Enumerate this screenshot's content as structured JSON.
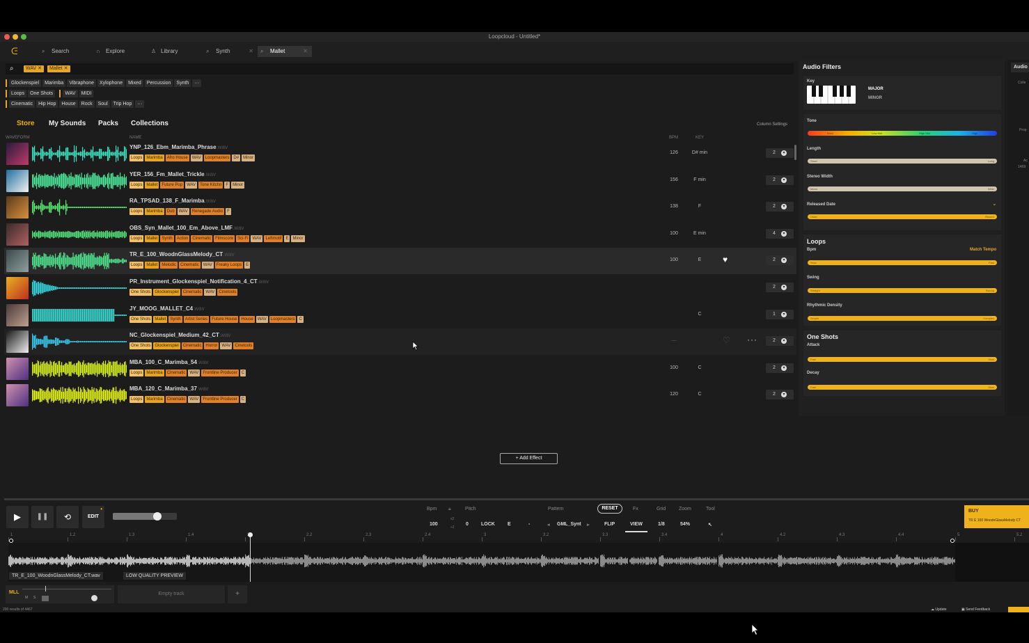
{
  "window": {
    "title": "Loopcloud - Untitled*"
  },
  "tabs": [
    {
      "icon": "search-icon",
      "label": "Search"
    },
    {
      "icon": "headphones-icon",
      "label": "Explore"
    },
    {
      "icon": "person-icon",
      "label": "Library"
    },
    {
      "icon": "search-icon",
      "label": "Synth"
    },
    {
      "icon": "search-icon",
      "label": "Mallet"
    }
  ],
  "search": {
    "chips": [
      "WAV",
      "Mallet"
    ]
  },
  "filters": {
    "row1": [
      "Glockenspiel",
      "Marimba",
      "Vibraphone",
      "Xylophone",
      "Mixed",
      "Percussion",
      "Synth",
      "···"
    ],
    "row2a": [
      "Loops",
      "One Shots"
    ],
    "row2b": [
      "WAV",
      "MIDI"
    ],
    "row3": [
      "Cinematic",
      "Hip Hop",
      "House",
      "Rock",
      "Soul",
      "Trip Hop",
      "···"
    ]
  },
  "nav": {
    "store": "Store",
    "my_sounds": "My Sounds",
    "packs": "Packs",
    "collections": "Collections",
    "column_settings": "Column Settings"
  },
  "columns": {
    "waveform": "WAVEFORM",
    "name": "NAME",
    "bpm": "BPM",
    "key": "KEY"
  },
  "rows": [
    {
      "name": "YNP_126_Ebm_Marimba_Phrase",
      "ext": ".wav",
      "bpm": "126",
      "key": "D# min",
      "count": "2",
      "tags": [
        "Loops",
        "Marimba",
        "Afro House",
        "WAV",
        "Loopmasters",
        "D#",
        "Minor"
      ],
      "wave_color": "#3fe0c0"
    },
    {
      "name": "YER_156_Fm_Mallet_Trickle",
      "ext": ".wav",
      "bpm": "156",
      "key": "F min",
      "count": "2",
      "tags": [
        "Loops",
        "Mallet",
        "Future Pop",
        "WAV",
        "Tone Kitchn",
        "F",
        "Minor"
      ],
      "wave_color": "#4ae898"
    },
    {
      "name": "RA_TPSAD_138_F_Marimba",
      "ext": ".wav",
      "bpm": "138",
      "key": "F",
      "count": "2",
      "tags": [
        "Loops",
        "Marimba",
        "Dub",
        "WAV",
        "Renegade Audio",
        "F"
      ],
      "wave_color": "#5ae670"
    },
    {
      "name": "OBS_Syn_Mallet_100_Em_Above_LMF",
      "ext": ".wav",
      "bpm": "100",
      "key": "E min",
      "count": "4",
      "tags": [
        "Loops",
        "Mallet",
        "Synth",
        "Action",
        "Cinematic",
        "Filmscore",
        "Sci-Fi",
        "WAV",
        "Leftmotif",
        "E",
        "Minor"
      ],
      "wave_color": "#52e07a"
    },
    {
      "name": "TR_E_100_WoodnGlassMelody_CT",
      "ext": ".wav",
      "bpm": "100",
      "key": "E",
      "count": "2",
      "tags": [
        "Loops",
        "Mallet",
        "Melodic",
        "Cinematic",
        "WAV",
        "Freaky Loops",
        "E"
      ],
      "wave_color": "#4ee38c"
    },
    {
      "name": "PR_Instrument_Glockenspiel_Notification_4_CT",
      "ext": ".wav",
      "bpm": "",
      "key": "",
      "count": "2",
      "tags": [
        "One Shots",
        "Glockenspiel",
        "Cinematic",
        "WAV",
        "Cinetools"
      ],
      "wave_color": "#35d8e0"
    },
    {
      "name": "JY_MOOG_MALLET_C4",
      "ext": ".wav",
      "bpm": "",
      "key": "C",
      "count": "1",
      "tags": [
        "One Shots",
        "Mallet",
        "Synth",
        "Artist Series",
        "Future House",
        "House",
        "WAV",
        "Loopmasters",
        "C"
      ],
      "wave_color": "#3cd8d0"
    },
    {
      "name": "NC_Glockenspiel_Medium_42_CT",
      "ext": ".wav",
      "bpm": "—",
      "key": "",
      "count": "2",
      "tags": [
        "One Shots",
        "Glockenspiel",
        "Cinematic",
        "Horror",
        "WAV",
        "Cinetools"
      ],
      "wave_color": "#38c8ec"
    },
    {
      "name": "MBA_100_C_Marimba_54",
      "ext": ".wav",
      "bpm": "100",
      "key": "C",
      "count": "2",
      "tags": [
        "Loops",
        "Marimba",
        "Cinematic",
        "WAV",
        "Frontline Producer",
        "C"
      ],
      "wave_color": "#d7f020"
    },
    {
      "name": "MBA_120_C_Marimba_37",
      "ext": ".wav",
      "bpm": "120",
      "key": "C",
      "count": "2",
      "tags": [
        "Loops",
        "Marimba",
        "Cinematic",
        "WAV",
        "Frontline Producer",
        "C"
      ],
      "wave_color": "#e2f21a"
    }
  ],
  "add_effect": "+ Add Effect",
  "audio_filters": {
    "title": "Audio Filters",
    "key_label": "Key",
    "major": "MAJOR",
    "minor": "MINOR",
    "tone": {
      "label": "Tone",
      "stops": [
        "Bass",
        "Low Mid",
        "High Mid",
        "High"
      ]
    },
    "length": {
      "label": "Length",
      "left": "Short",
      "right": "Long"
    },
    "stereo": {
      "label": "Stereo Width",
      "left": "Mono",
      "right": "Wide"
    },
    "released": {
      "label": "Released Date",
      "left": "Older",
      "right": "Recent"
    },
    "loops_title": "Loops",
    "bpm": {
      "label": "Bpm",
      "match": "Match Tempo",
      "left": "Slow",
      "right": "Fast"
    },
    "swing": {
      "label": "Swing",
      "left": "Straight",
      "right": "Swung"
    },
    "density": {
      "label": "Rhythmic Density",
      "left": "Simple",
      "right": "Complex"
    },
    "oneshots_title": "One Shots",
    "attack": {
      "label": "Attack",
      "left": "Fast",
      "right": "Slow"
    },
    "decay": {
      "label": "Decay",
      "left": "Fast",
      "right": "Slow"
    }
  },
  "far_right": {
    "tab": "Audio",
    "labels": [
      "Colle",
      "Prop",
      "Ac",
      "1469"
    ]
  },
  "transport": {
    "edit": "EDIT",
    "volume_level": 0.7,
    "bpm_label": "Bpm",
    "bpm_value": "100",
    "pitch_label": "Pitch",
    "pitch_value": "0",
    "lock": "LOCK",
    "key_value": "E",
    "dash": "-",
    "pattern_label": "Pattern",
    "pattern_value": "GML_Synt",
    "reset": "RESET",
    "fx_label": "Fx",
    "flip": "FLIP",
    "grid_label": "Grid",
    "view": "VIEW",
    "grid_value": "1/8",
    "zoom_label": "Zoom",
    "zoom_value": "54%",
    "tool_label": "Tool",
    "x2": "x2",
    "d2": "÷2"
  },
  "buy": {
    "label": "BUY",
    "sub": "TR E 100 WoodnGlassMelody CT"
  },
  "ruler": [
    "1",
    "1.2",
    "1.3",
    "1.4",
    "2",
    "2.2",
    "2.3",
    "2.4",
    "3",
    "3.2",
    "3.3",
    "3.4",
    "4",
    "4.2",
    "4.3",
    "4.4",
    "5",
    "5.2"
  ],
  "timeline": {
    "file": "TR_E_100_WoodnGlassMelody_CT.wav",
    "quality": "LOW QUALITY PREVIEW"
  },
  "track": {
    "name": "MLL",
    "m": "M",
    "s": "S",
    "empty": "Empty track",
    "add": "+"
  },
  "footer": {
    "results": "200 results of 4467",
    "update": "Update",
    "feedback": "Send Feedback"
  },
  "colors": {
    "accent": "#f0b21a",
    "bg": "#1c1c1c"
  }
}
